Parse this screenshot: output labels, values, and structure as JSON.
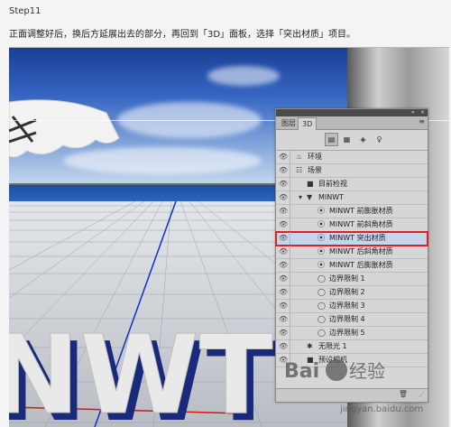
{
  "step_title": "Step11",
  "instruction": "正面调整好后，换后方延展出去的部分，再回到「3D」面板，选择「突出材质」项目。",
  "panel": {
    "tabs": [
      {
        "label": "图层",
        "active": false
      },
      {
        "label": "3D",
        "active": true
      }
    ],
    "menu_icon": "panel-menu-icon",
    "filter_icons": [
      "scene-filter-icon",
      "mesh-filter-icon",
      "material-filter-icon",
      "light-filter-icon"
    ],
    "rows": [
      {
        "label": "环境",
        "icon": "environment-icon",
        "indent": 0,
        "expand": false,
        "selected": false
      },
      {
        "label": "场景",
        "icon": "scene-icon",
        "indent": 0,
        "expand": false,
        "selected": false
      },
      {
        "label": "目前检视",
        "icon": "camera-icon",
        "indent": 1,
        "expand": false,
        "selected": false
      },
      {
        "label": "MINWT",
        "icon": "mesh-icon",
        "indent": 1,
        "expand": true,
        "selected": false
      },
      {
        "label": "MINWT 前膨胀材质",
        "icon": "material-icon",
        "indent": 2,
        "expand": false,
        "selected": false
      },
      {
        "label": "MINWT 前斜角材质",
        "icon": "material-icon",
        "indent": 2,
        "expand": false,
        "selected": false
      },
      {
        "label": "MINWT 突出材质",
        "icon": "material-icon",
        "indent": 2,
        "expand": false,
        "selected": true
      },
      {
        "label": "MINWT 后斜角材质",
        "icon": "material-icon",
        "indent": 2,
        "expand": false,
        "selected": false
      },
      {
        "label": "MINWT 后膨胀材质",
        "icon": "material-icon",
        "indent": 2,
        "expand": false,
        "selected": false
      },
      {
        "label": "边界限制 1",
        "icon": "constraint-icon",
        "indent": 2,
        "expand": false,
        "selected": false
      },
      {
        "label": "边界限制 2",
        "icon": "constraint-icon",
        "indent": 2,
        "expand": false,
        "selected": false
      },
      {
        "label": "边界限制 3",
        "icon": "constraint-icon",
        "indent": 2,
        "expand": false,
        "selected": false
      },
      {
        "label": "边界限制 4",
        "icon": "constraint-icon",
        "indent": 2,
        "expand": false,
        "selected": false
      },
      {
        "label": "边界限制 5",
        "icon": "constraint-icon",
        "indent": 2,
        "expand": false,
        "selected": false
      },
      {
        "label": "无限光 1",
        "icon": "light-icon",
        "indent": 1,
        "expand": false,
        "selected": false
      },
      {
        "label": "预设相机",
        "icon": "camera-icon",
        "indent": 1,
        "expand": false,
        "selected": false
      }
    ]
  },
  "scene_text": "MINWT",
  "watermark": {
    "brand": "Bai",
    "brand2": "经验",
    "url": "jingyan.baidu.com"
  },
  "colors": {
    "selection_outline": "#e02020",
    "selection_fill": "#c7d4ee",
    "accent_blue": "#1a3f96"
  }
}
